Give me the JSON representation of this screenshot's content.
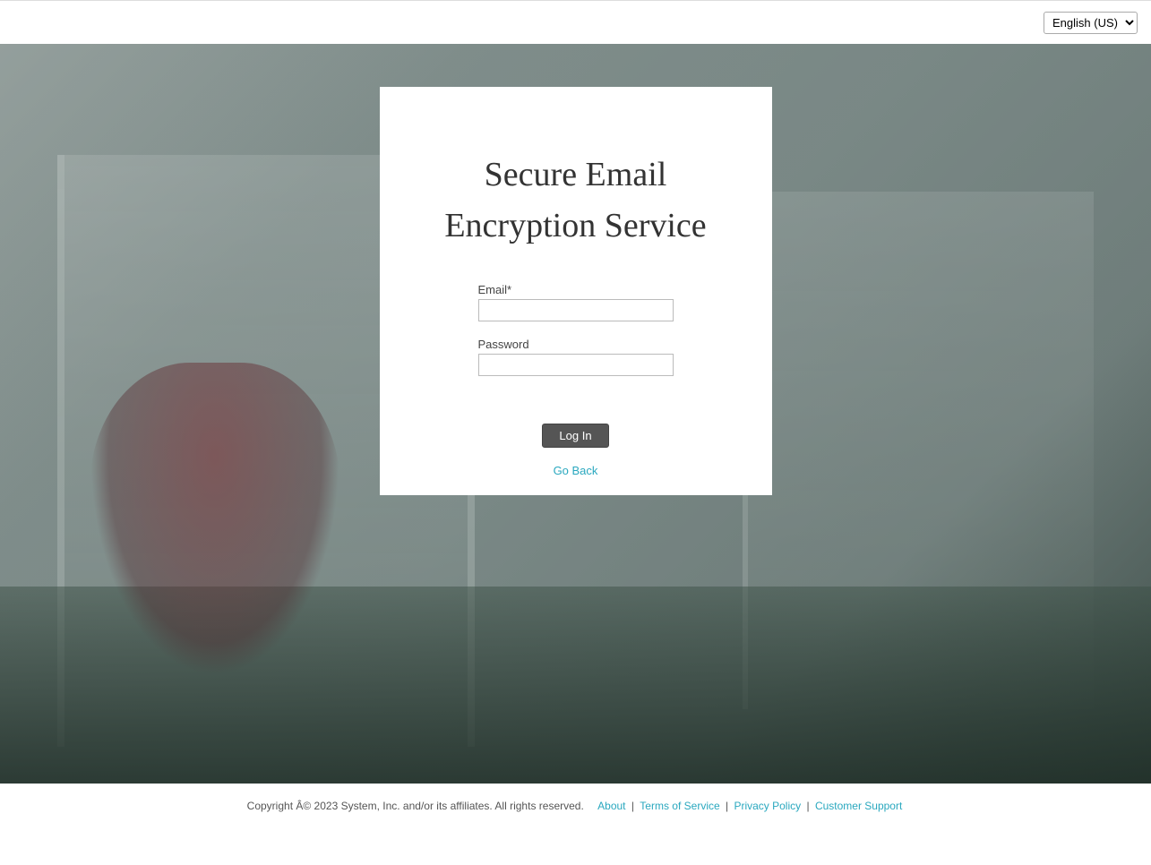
{
  "topbar": {
    "language_selected": "English (US)"
  },
  "card": {
    "title": "Secure Email Encryption Service",
    "email_label": "Email*",
    "password_label": "Password",
    "login_button": "Log In",
    "go_back": "Go Back"
  },
  "footer": {
    "copyright": "Copyright Â© 2023 System, Inc. and/or its affiliates. All rights reserved.",
    "links": {
      "about": "About",
      "terms": "Terms of Service",
      "privacy": "Privacy Policy",
      "support": "Customer Support"
    },
    "separator": " | "
  }
}
